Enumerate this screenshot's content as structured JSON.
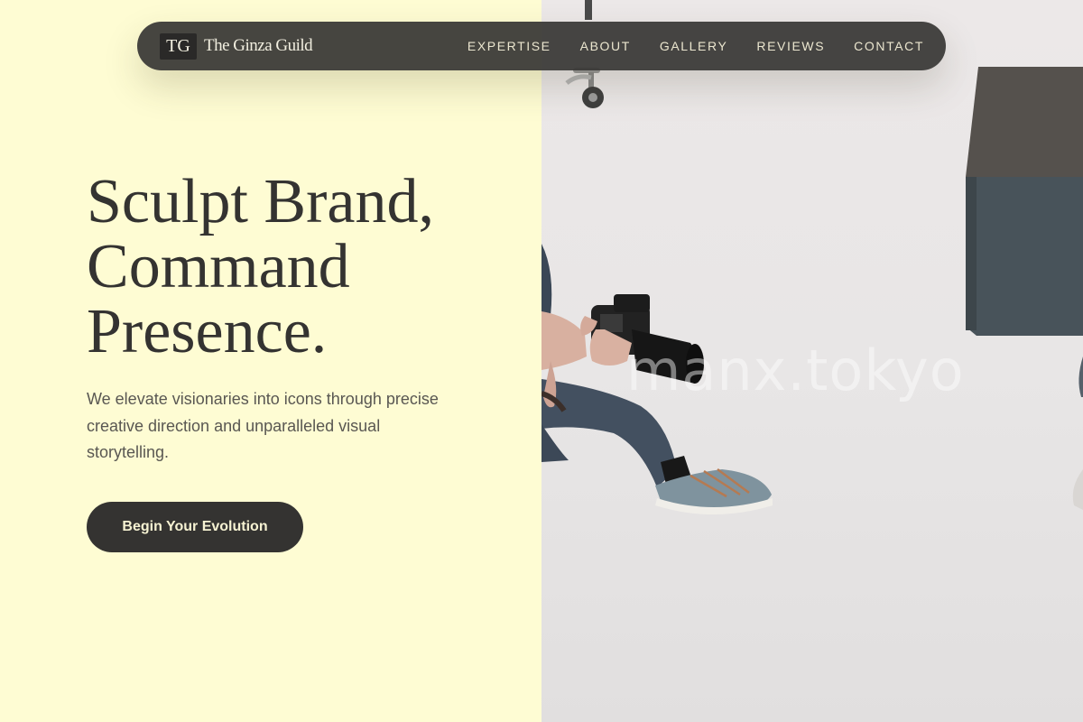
{
  "nav": {
    "brand_mark": "TG",
    "brand_name": "The Ginza Guild",
    "links": [
      "EXPERTISE",
      "ABOUT",
      "GALLERY",
      "REVIEWS",
      "CONTACT"
    ]
  },
  "hero": {
    "title_lines": [
      "Sculpt Brand,",
      "Command",
      "Presence."
    ],
    "subtitle": "We elevate visionaries into icons through precise creative direction and unparalleled visual storytelling.",
    "cta_label": "Begin Your Evolution"
  },
  "photo": {
    "watermark": "manx.tokyo"
  },
  "colors": {
    "left_background": "#fefcd3",
    "dark": "#343331",
    "nav_background": "#383735",
    "nav_text": "#ebe6cf"
  }
}
